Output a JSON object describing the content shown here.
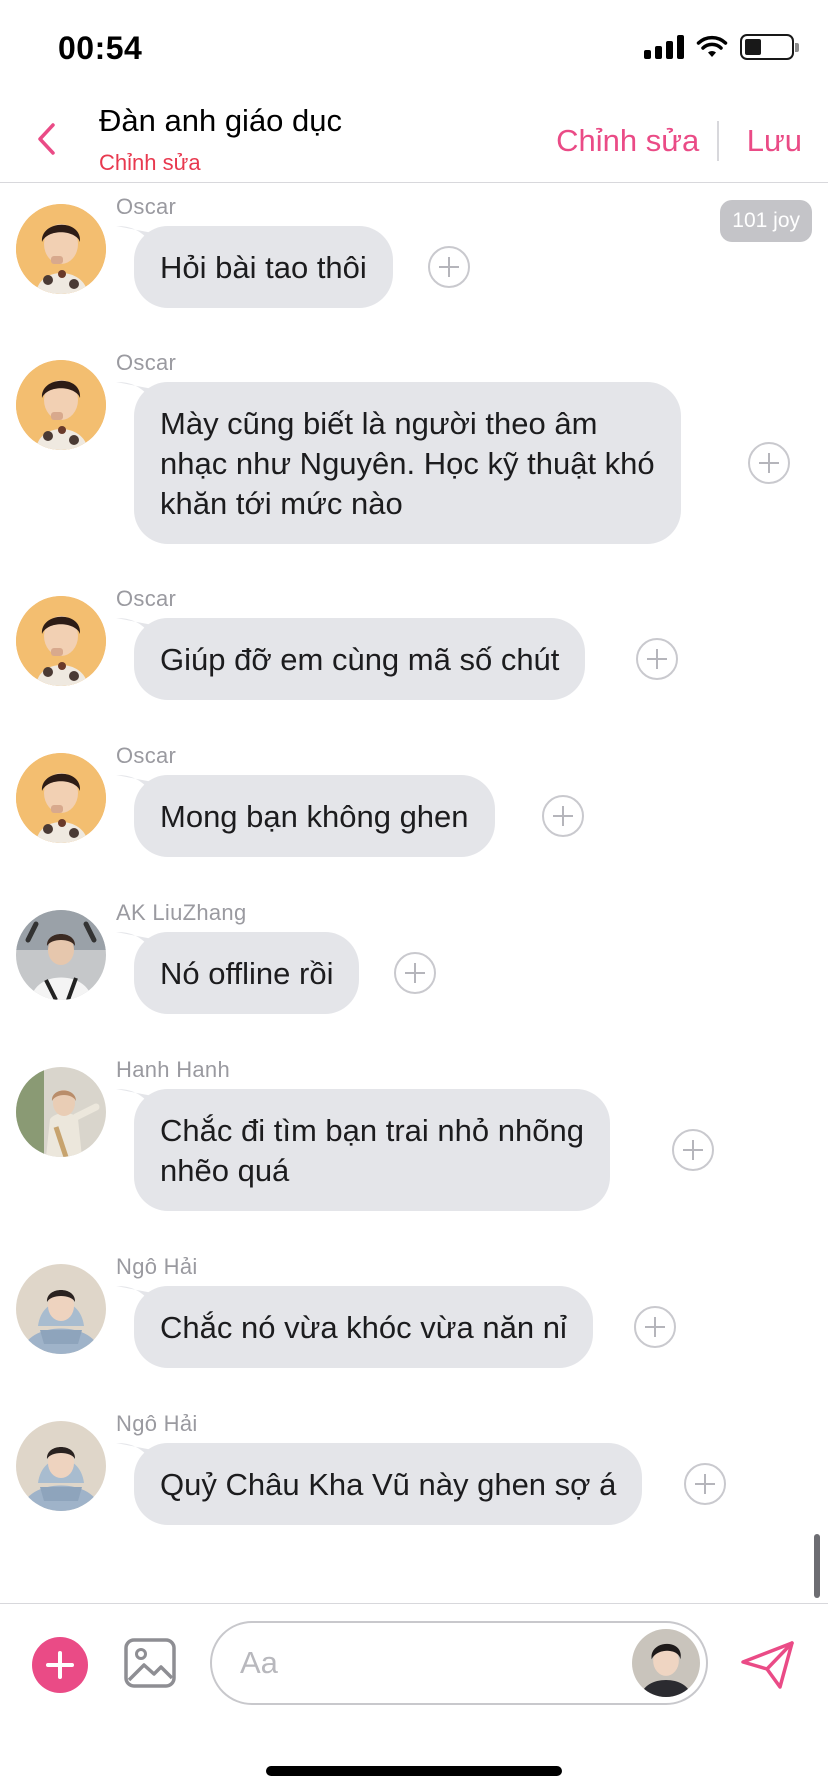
{
  "status_bar": {
    "time": "00:54"
  },
  "header": {
    "title": "Đàn anh giáo dục",
    "subtitle": "Chỉnh sửa",
    "edit_label": "Chỉnh sửa",
    "save_label": "Lưu",
    "accent_color": "#ea4b86",
    "subtitle_color": "#e8394f"
  },
  "badge": {
    "text": "101 joy"
  },
  "messages": [
    {
      "sender": "Oscar",
      "lines": [
        "Hỏi bài tao thôi"
      ],
      "avatar": "avatar-oscar"
    },
    {
      "sender": "Oscar",
      "lines": [
        "Mày cũng biết là người theo âm",
        "nhạc như Nguyên. Học kỹ thuật khó",
        "khăn tới mức nào"
      ],
      "avatar": "avatar-oscar"
    },
    {
      "sender": "Oscar",
      "lines": [
        "Giúp đỡ em cùng mã số chút"
      ],
      "avatar": "avatar-oscar"
    },
    {
      "sender": "Oscar",
      "lines": [
        "Mong bạn không ghen"
      ],
      "avatar": "avatar-oscar"
    },
    {
      "sender": "AK LiuZhang",
      "lines": [
        "Nó offline rồi"
      ],
      "avatar": "avatar-ak"
    },
    {
      "sender": "Hanh Hanh",
      "lines": [
        "Chắc đi tìm bạn trai nhỏ nhõng",
        "nhẽo quá"
      ],
      "avatar": "avatar-hanh"
    },
    {
      "sender": "Ngô Hải",
      "lines": [
        "Chắc nó vừa khóc vừa năn nỉ"
      ],
      "avatar": "avatar-ngo"
    },
    {
      "sender": "Ngô Hải",
      "lines": [
        "Quỷ Châu Kha Vũ này ghen sợ á"
      ],
      "avatar": "avatar-ngo"
    }
  ],
  "composer": {
    "placeholder": "Aa"
  },
  "colors": {
    "bubble": "#e4e5e9",
    "accent": "#ea4b86"
  }
}
